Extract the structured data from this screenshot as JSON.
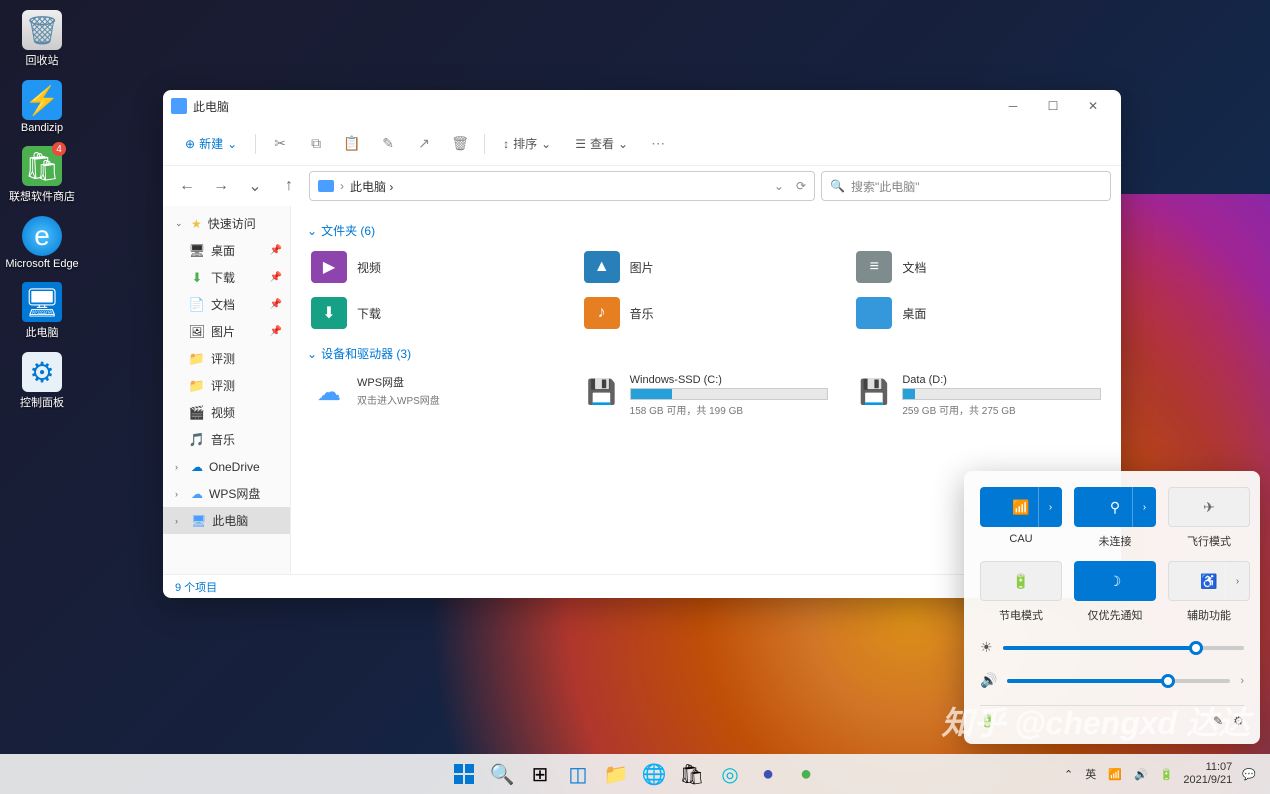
{
  "desktop": {
    "icons": [
      {
        "label": "回收站",
        "color": "#5d8aa8"
      },
      {
        "label": "Bandizip",
        "color": "#2196f3"
      },
      {
        "label": "联想软件商店",
        "color": "#4caf50",
        "badge": "4"
      },
      {
        "label": "Microsoft Edge",
        "color": "#0078d4"
      },
      {
        "label": "此电脑",
        "color": "#0078d4"
      },
      {
        "label": "控制面板",
        "color": "#0078d4"
      }
    ]
  },
  "explorer": {
    "title": "此电脑",
    "toolbar": {
      "new": "新建",
      "sort": "排序",
      "view": "查看"
    },
    "address": "此电脑 ›",
    "search_placeholder": "搜索\"此电脑\"",
    "sidebar": {
      "quick_access": "快速访问",
      "items": [
        {
          "label": "桌面",
          "icon": "🖥",
          "color": "#4a9eff"
        },
        {
          "label": "下载",
          "icon": "⬇",
          "color": "#4caf50"
        },
        {
          "label": "文档",
          "icon": "📄",
          "color": "#5b9bd5"
        },
        {
          "label": "图片",
          "icon": "🖼",
          "color": "#4a9eff"
        },
        {
          "label": "评测",
          "icon": "📁",
          "color": "#f0c040"
        },
        {
          "label": "评测",
          "icon": "📁",
          "color": "#f0c040"
        },
        {
          "label": "视频",
          "icon": "🎬",
          "color": "#8e44ad"
        },
        {
          "label": "音乐",
          "icon": "🎵",
          "color": "#e67e22"
        }
      ],
      "onedrive": "OneDrive",
      "wps": "WPS网盘",
      "thispc": "此电脑"
    },
    "sections": {
      "folders_header": "文件夹 (6)",
      "folders": [
        {
          "name": "视频",
          "color": "#8e44ad",
          "glyph": "▶"
        },
        {
          "name": "图片",
          "color": "#2980b9",
          "glyph": "▲"
        },
        {
          "name": "文档",
          "color": "#7f8c8d",
          "glyph": "≡"
        },
        {
          "name": "下载",
          "color": "#16a085",
          "glyph": "⬇"
        },
        {
          "name": "音乐",
          "color": "#e67e22",
          "glyph": "♪"
        },
        {
          "name": "桌面",
          "color": "#3498db",
          "glyph": ""
        }
      ],
      "drives_header": "设备和驱动器 (3)",
      "drives": [
        {
          "name": "WPS网盘",
          "sub": "双击进入WPS网盘",
          "type": "cloud"
        },
        {
          "name": "Windows-SSD (C:)",
          "sub": "158 GB 可用，共 199 GB",
          "fill": 21
        },
        {
          "name": "Data (D:)",
          "sub": "259 GB 可用，共 275 GB",
          "fill": 6
        }
      ]
    },
    "status": "9 个项目"
  },
  "quick_settings": {
    "tiles": [
      {
        "label": "CAU",
        "state": "on",
        "expand": true,
        "glyph": "📶"
      },
      {
        "label": "未连接",
        "state": "on",
        "expand": true,
        "glyph": "⚲"
      },
      {
        "label": "飞行模式",
        "state": "off",
        "glyph": "✈"
      },
      {
        "label": "节电模式",
        "state": "off",
        "glyph": "🔋"
      },
      {
        "label": "仅优先通知",
        "state": "on",
        "glyph": "☽"
      },
      {
        "label": "辅助功能",
        "state": "off",
        "expand": true,
        "glyph": "♿"
      }
    ],
    "brightness": 80,
    "volume": 72
  },
  "taskbar": {
    "ime": "英",
    "time": "11:07",
    "date": "2021/9/21"
  },
  "watermark": "知乎 @chengxd 达达"
}
